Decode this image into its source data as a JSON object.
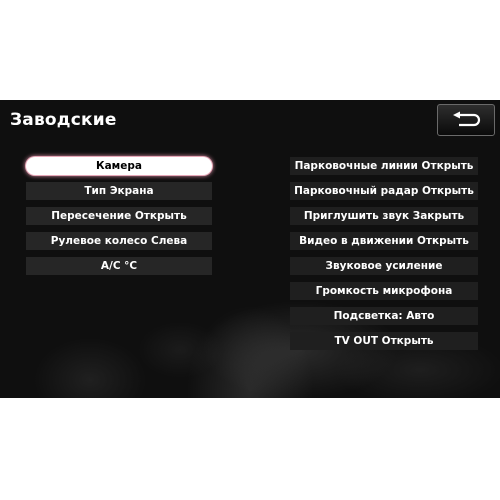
{
  "header": {
    "title": "Заводские",
    "back_icon": "return-arrow-icon"
  },
  "left_menu": {
    "items": [
      {
        "label": "Камера",
        "selected": true
      },
      {
        "label": "Тип Экрана",
        "selected": false
      },
      {
        "label": "Пересечение Открыть",
        "selected": false
      },
      {
        "label": "Рулевое колесо Слева",
        "selected": false
      },
      {
        "label": "A/C °C",
        "selected": false
      }
    ]
  },
  "right_menu": {
    "items": [
      {
        "label": "Парковочные линии Открыть"
      },
      {
        "label": "Парковочный радар Открыть"
      },
      {
        "label": "Приглушить звук Закрыть"
      },
      {
        "label": "Видео в движении Открыть"
      },
      {
        "label": "Звуковое усиление"
      },
      {
        "label": "Громкость микрофона"
      },
      {
        "label": "Подсветка: Авто"
      },
      {
        "label": "TV OUT Открыть"
      }
    ]
  },
  "colors": {
    "panel_background": "#0f0f0f",
    "row_background": "#262626",
    "selected_background": "#ffffff",
    "selected_glow": "#d98ea4",
    "text": "#ffffff"
  }
}
